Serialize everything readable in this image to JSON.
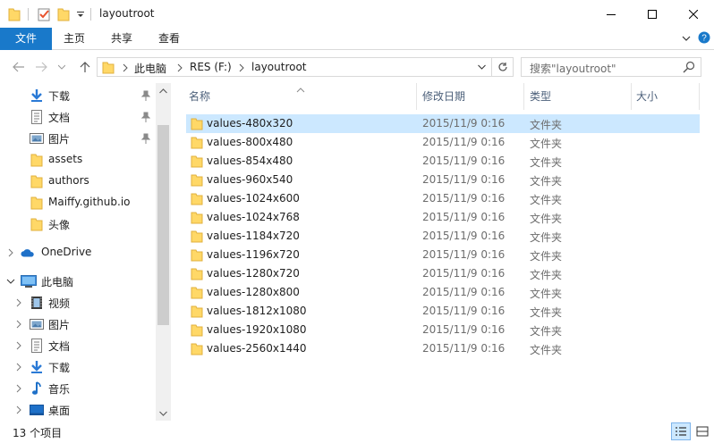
{
  "window": {
    "title": "layoutroot",
    "accent": "#1979ca"
  },
  "ribbon": {
    "tabs": [
      {
        "label": "文件"
      },
      {
        "label": "主页"
      },
      {
        "label": "共享"
      },
      {
        "label": "查看"
      }
    ]
  },
  "address": {
    "crumbs": [
      "此电脑",
      "RES (F:)",
      "layoutroot"
    ],
    "search_placeholder": "搜索\"layoutroot\""
  },
  "nav": {
    "quick_access": [
      {
        "label": "下载",
        "icon": "download-icon",
        "pinned": true
      },
      {
        "label": "文档",
        "icon": "document-icon",
        "pinned": true
      },
      {
        "label": "图片",
        "icon": "pictures-icon",
        "pinned": true
      },
      {
        "label": "assets",
        "icon": "folder-icon",
        "pinned": false
      },
      {
        "label": "authors",
        "icon": "folder-icon",
        "pinned": false
      },
      {
        "label": "Maiffy.github.io",
        "icon": "folder-icon",
        "pinned": false
      },
      {
        "label": "头像",
        "icon": "folder-icon",
        "pinned": false
      }
    ],
    "onedrive": {
      "label": "OneDrive"
    },
    "this_pc": {
      "label": "此电脑"
    },
    "pc_items": [
      {
        "label": "视频",
        "icon": "video-icon"
      },
      {
        "label": "图片",
        "icon": "pictures-icon"
      },
      {
        "label": "文档",
        "icon": "document-icon"
      },
      {
        "label": "下载",
        "icon": "download-icon"
      },
      {
        "label": "音乐",
        "icon": "music-icon"
      },
      {
        "label": "桌面",
        "icon": "desktop-icon"
      }
    ]
  },
  "columns": {
    "name": "名称",
    "date": "修改日期",
    "type": "类型",
    "size": "大小"
  },
  "files": [
    {
      "name": "values-480x320",
      "date": "2015/11/9 0:16",
      "type": "文件夹",
      "selected": true
    },
    {
      "name": "values-800x480",
      "date": "2015/11/9 0:16",
      "type": "文件夹"
    },
    {
      "name": "values-854x480",
      "date": "2015/11/9 0:16",
      "type": "文件夹"
    },
    {
      "name": "values-960x540",
      "date": "2015/11/9 0:16",
      "type": "文件夹"
    },
    {
      "name": "values-1024x600",
      "date": "2015/11/9 0:16",
      "type": "文件夹"
    },
    {
      "name": "values-1024x768",
      "date": "2015/11/9 0:16",
      "type": "文件夹"
    },
    {
      "name": "values-1184x720",
      "date": "2015/11/9 0:16",
      "type": "文件夹"
    },
    {
      "name": "values-1196x720",
      "date": "2015/11/9 0:16",
      "type": "文件夹"
    },
    {
      "name": "values-1280x720",
      "date": "2015/11/9 0:16",
      "type": "文件夹"
    },
    {
      "name": "values-1280x800",
      "date": "2015/11/9 0:16",
      "type": "文件夹"
    },
    {
      "name": "values-1812x1080",
      "date": "2015/11/9 0:16",
      "type": "文件夹"
    },
    {
      "name": "values-1920x1080",
      "date": "2015/11/9 0:16",
      "type": "文件夹"
    },
    {
      "name": "values-2560x1440",
      "date": "2015/11/9 0:16",
      "type": "文件夹"
    }
  ],
  "status": {
    "item_count": "13 个项目"
  }
}
